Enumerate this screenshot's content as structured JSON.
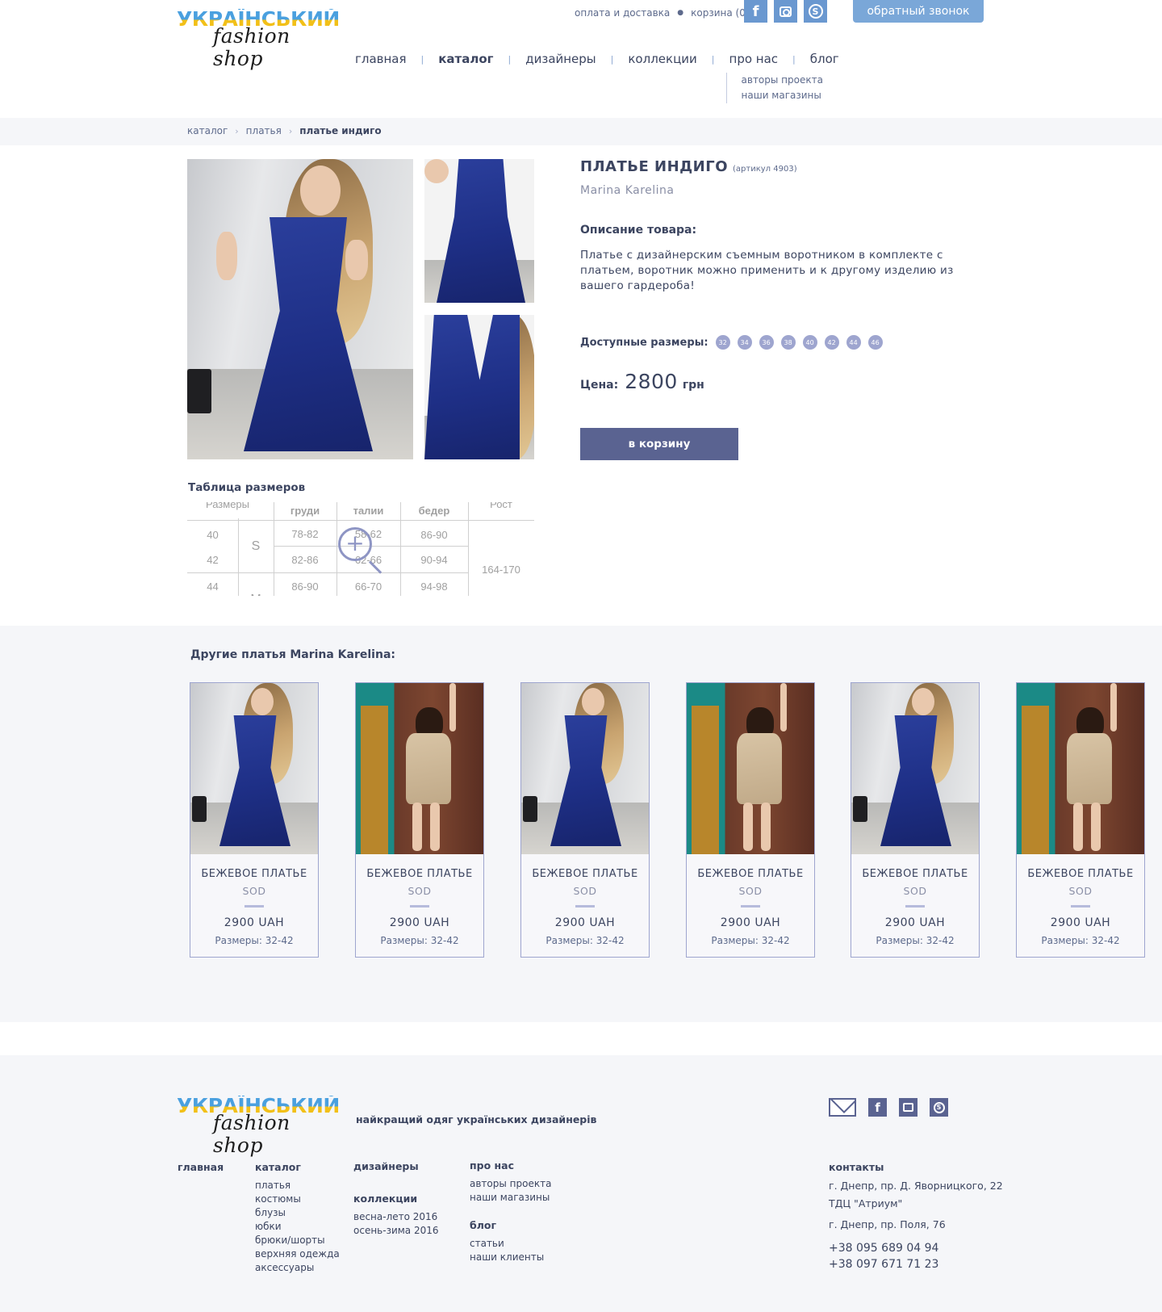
{
  "header": {
    "logo": {
      "top": "УКРАЇНСЬКИЙ",
      "bottom": "fashion shop"
    },
    "top_links": [
      "оплата и доставка",
      "корзина (0)"
    ],
    "social": [
      "facebook",
      "instagram",
      "skype"
    ],
    "callback": "обратный звонок",
    "nav": [
      {
        "label": "главная"
      },
      {
        "label": "каталог",
        "active": true
      },
      {
        "label": "дизайнеры"
      },
      {
        "label": "коллекции"
      },
      {
        "label": "про нас",
        "sub": [
          "авторы проекта",
          "наши магазины"
        ]
      },
      {
        "label": "блог"
      }
    ]
  },
  "breadcrumb": [
    "каталог",
    "платья",
    "платье индиго"
  ],
  "product": {
    "title": "ПЛАТЬЕ ИНДИГО",
    "article": "(артикул 4903)",
    "brand": "Marina Karelina",
    "desc_heading": "Описание товара:",
    "description": "Платье с  дизайнерским съемным воротником в комплекте с платьем, воротник можно применить и к другому изделию из вашего гардероба!",
    "sizes_label": "Доступные размеры:",
    "sizes": [
      "32",
      "34",
      "36",
      "38",
      "40",
      "42",
      "44",
      "46"
    ],
    "price_label": "Цена:",
    "price": "2800",
    "currency": "грн",
    "cart_button": "в корзину"
  },
  "size_table": {
    "title": "Таблица размеров",
    "headers": [
      "Размеры",
      "груди",
      "талии",
      "бедер",
      "Рост"
    ],
    "rows": [
      {
        "size": "40",
        "bust": "78-82",
        "waist": "58-62",
        "hips": "86-90"
      },
      {
        "size": "42",
        "bust": "82-86",
        "waist": "62-66",
        "hips": "90-94"
      },
      {
        "size": "44",
        "bust": "86-90",
        "waist": "66-70",
        "hips": "94-98"
      }
    ],
    "letter_s": "S",
    "letter_m": "M",
    "height": "164-170"
  },
  "other": {
    "heading": "Другие платья Marina Karelina:",
    "cards": [
      {
        "name": "БЕЖЕВОЕ ПЛАТЬЕ",
        "brand": "SOD",
        "price": "2900 UAH",
        "sizes": "Размеры: 32-42",
        "photo": "blue-dress"
      },
      {
        "name": "БЕЖЕВОЕ ПЛАТЬЕ",
        "brand": "SOD",
        "price": "2900 UAH",
        "sizes": "Размеры: 32-42",
        "photo": "beige-dress"
      },
      {
        "name": "БЕЖЕВОЕ ПЛАТЬЕ",
        "brand": "SOD",
        "price": "2900 UAH",
        "sizes": "Размеры: 32-42",
        "photo": "blue-dress"
      },
      {
        "name": "БЕЖЕВОЕ ПЛАТЬЕ",
        "brand": "SOD",
        "price": "2900 UAH",
        "sizes": "Размеры: 32-42",
        "photo": "beige-dress"
      },
      {
        "name": "БЕЖЕВОЕ ПЛАТЬЕ",
        "brand": "SOD",
        "price": "2900 UAH",
        "sizes": "Размеры: 32-42",
        "photo": "blue-dress"
      },
      {
        "name": "БЕЖЕВОЕ ПЛАТЬЕ",
        "brand": "SOD",
        "price": "2900 UAH",
        "sizes": "Размеры: 32-42",
        "photo": "beige-dress"
      }
    ]
  },
  "footer": {
    "tagline": "найкращий одяг українських дизайнерів",
    "social": [
      "mail",
      "facebook",
      "instagram",
      "skype"
    ],
    "col_main": "главная",
    "col_catalog": {
      "heading": "каталог",
      "items": [
        "платья",
        "костюмы",
        "блузы",
        "юбки",
        "брюки/шорты",
        "верхняя одежда",
        "аксессуары"
      ]
    },
    "col_designers": "дизайнеры",
    "col_collections": {
      "heading": "коллекции",
      "items": [
        "весна-лето 2016",
        "осень-зима 2016"
      ]
    },
    "col_about": {
      "heading": "про нас",
      "items": [
        "авторы проекта",
        "наши магазины"
      ]
    },
    "col_blog": {
      "heading": "блог",
      "items": [
        "статьи",
        "наши клиенты"
      ]
    },
    "contacts": {
      "heading": "контакты",
      "addr1": "г. Днепр, пр. Д. Яворницкого, 22",
      "addr1b": "ТДЦ \"Атриум\"",
      "addr2": "г. Днепр, пр. Поля, 76",
      "phone1": "+38 095 689 04 94",
      "phone2": "+38 097 671 71 23"
    }
  },
  "colors": {
    "accent": "#5a6391",
    "chip": "#9ea5cf",
    "callback": "#7aa7d8",
    "social": "#6a98d0"
  }
}
